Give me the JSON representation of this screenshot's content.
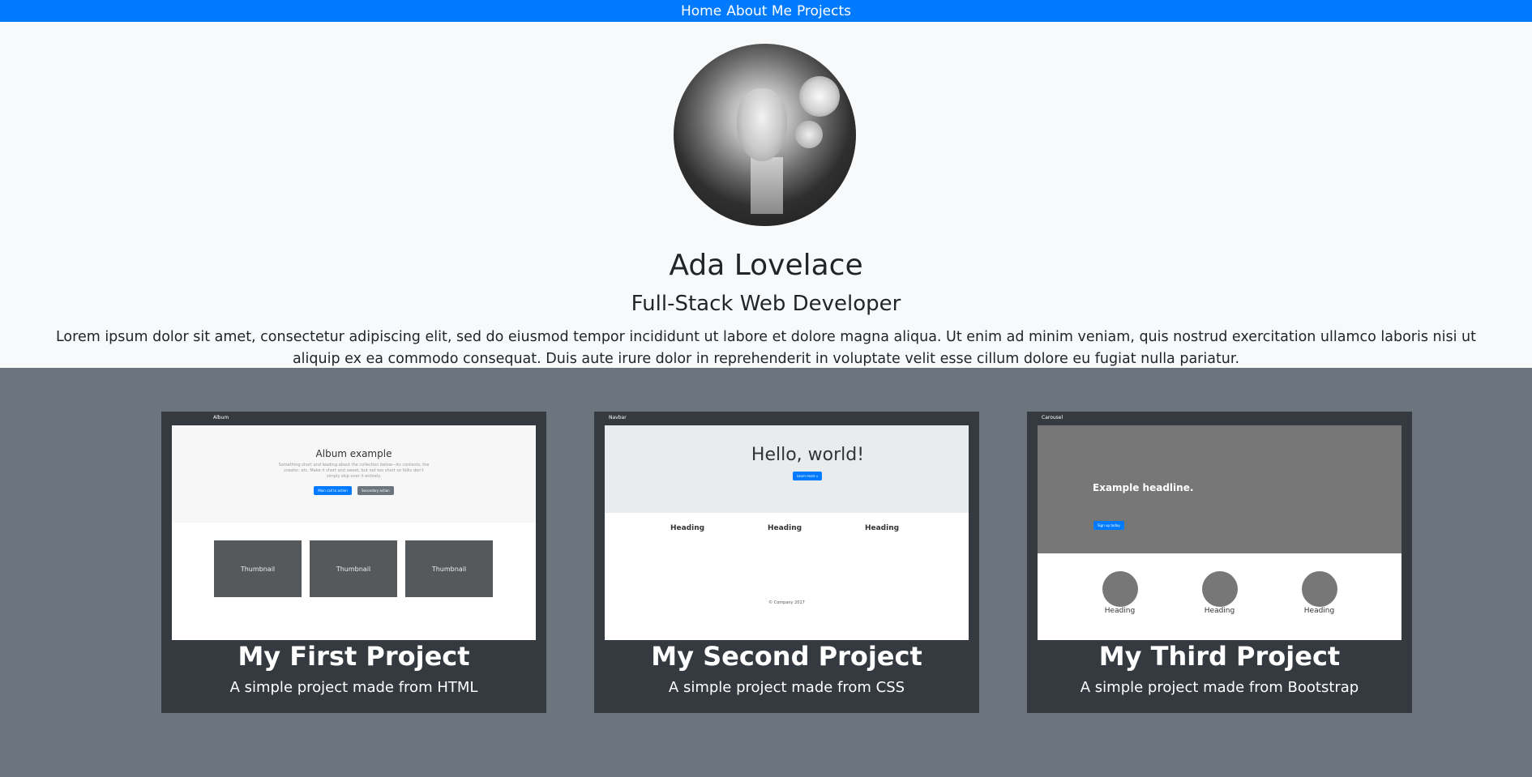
{
  "nav": {
    "items": [
      "Home",
      "About Me",
      "Projects"
    ]
  },
  "profile": {
    "name": "Ada Lovelace",
    "role": "Full-Stack Web Developer",
    "bio": "Lorem ipsum dolor sit amet, consectetur adipiscing elit, sed do eiusmod tempor incididunt ut labore et dolore magna aliqua. Ut enim ad minim veniam, quis nostrud exercitation ullamco laboris nisi ut aliquip ex ea commodo consequat. Duis aute irure dolor in reprehenderit in voluptate velit esse cillum dolore eu fugiat nulla pariatur."
  },
  "projects": [
    {
      "title": "My First Project",
      "subtitle": "A simple project made from HTML",
      "preview": {
        "brand": "Album",
        "heading": "Album example",
        "text": "Something short and leading about the collection below—its contents, the creator, etc. Make it short and sweet, but not too short so folks don't simply skip over it entirely.",
        "primary": "Main call to action",
        "secondary": "Secondary action",
        "thumb": "Thumbnail"
      }
    },
    {
      "title": "My Second Project",
      "subtitle": "A simple project made from CSS",
      "preview": {
        "brand": "Navbar",
        "heading": "Hello, world!",
        "button": "Learn more »",
        "col": "Heading",
        "footer": "© Company 2017"
      }
    },
    {
      "title": "My Third Project",
      "subtitle": "A simple project made from Bootstrap",
      "preview": {
        "brand": "Carousel",
        "heading": "Example headline.",
        "button": "Sign up today",
        "col": "Heading"
      }
    }
  ],
  "colors": {
    "nav": "#007bff",
    "page": "#f8f9fa",
    "projects_bg": "#6c757d",
    "card_bg": "#343a40"
  }
}
